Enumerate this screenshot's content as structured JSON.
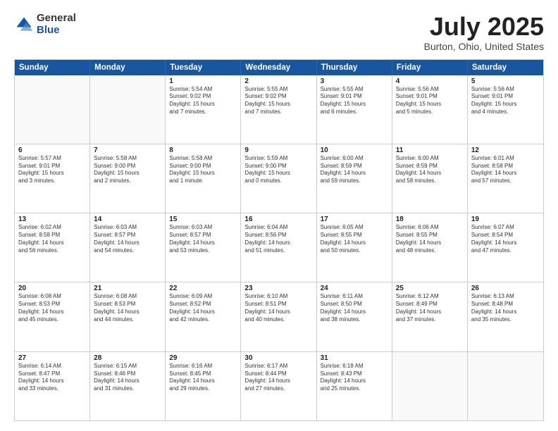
{
  "logo": {
    "general": "General",
    "blue": "Blue"
  },
  "title": "July 2025",
  "subtitle": "Burton, Ohio, United States",
  "header_days": [
    "Sunday",
    "Monday",
    "Tuesday",
    "Wednesday",
    "Thursday",
    "Friday",
    "Saturday"
  ],
  "rows": [
    [
      {
        "day": "",
        "lines": [],
        "empty": true
      },
      {
        "day": "",
        "lines": [],
        "empty": true
      },
      {
        "day": "1",
        "lines": [
          "Sunrise: 5:54 AM",
          "Sunset: 9:02 PM",
          "Daylight: 15 hours",
          "and 7 minutes."
        ]
      },
      {
        "day": "2",
        "lines": [
          "Sunrise: 5:55 AM",
          "Sunset: 9:02 PM",
          "Daylight: 15 hours",
          "and 7 minutes."
        ]
      },
      {
        "day": "3",
        "lines": [
          "Sunrise: 5:55 AM",
          "Sunset: 9:01 PM",
          "Daylight: 15 hours",
          "and 6 minutes."
        ]
      },
      {
        "day": "4",
        "lines": [
          "Sunrise: 5:56 AM",
          "Sunset: 9:01 PM",
          "Daylight: 15 hours",
          "and 5 minutes."
        ]
      },
      {
        "day": "5",
        "lines": [
          "Sunrise: 5:56 AM",
          "Sunset: 9:01 PM",
          "Daylight: 15 hours",
          "and 4 minutes."
        ]
      }
    ],
    [
      {
        "day": "6",
        "lines": [
          "Sunrise: 5:57 AM",
          "Sunset: 9:01 PM",
          "Daylight: 15 hours",
          "and 3 minutes."
        ]
      },
      {
        "day": "7",
        "lines": [
          "Sunrise: 5:58 AM",
          "Sunset: 9:00 PM",
          "Daylight: 15 hours",
          "and 2 minutes."
        ]
      },
      {
        "day": "8",
        "lines": [
          "Sunrise: 5:58 AM",
          "Sunset: 9:00 PM",
          "Daylight: 15 hours",
          "and 1 minute."
        ]
      },
      {
        "day": "9",
        "lines": [
          "Sunrise: 5:59 AM",
          "Sunset: 9:00 PM",
          "Daylight: 15 hours",
          "and 0 minutes."
        ]
      },
      {
        "day": "10",
        "lines": [
          "Sunrise: 6:00 AM",
          "Sunset: 8:59 PM",
          "Daylight: 14 hours",
          "and 59 minutes."
        ]
      },
      {
        "day": "11",
        "lines": [
          "Sunrise: 6:00 AM",
          "Sunset: 8:59 PM",
          "Daylight: 14 hours",
          "and 58 minutes."
        ]
      },
      {
        "day": "12",
        "lines": [
          "Sunrise: 6:01 AM",
          "Sunset: 8:58 PM",
          "Daylight: 14 hours",
          "and 57 minutes."
        ]
      }
    ],
    [
      {
        "day": "13",
        "lines": [
          "Sunrise: 6:02 AM",
          "Sunset: 8:58 PM",
          "Daylight: 14 hours",
          "and 56 minutes."
        ]
      },
      {
        "day": "14",
        "lines": [
          "Sunrise: 6:03 AM",
          "Sunset: 8:57 PM",
          "Daylight: 14 hours",
          "and 54 minutes."
        ]
      },
      {
        "day": "15",
        "lines": [
          "Sunrise: 6:03 AM",
          "Sunset: 8:57 PM",
          "Daylight: 14 hours",
          "and 53 minutes."
        ]
      },
      {
        "day": "16",
        "lines": [
          "Sunrise: 6:04 AM",
          "Sunset: 8:56 PM",
          "Daylight: 14 hours",
          "and 51 minutes."
        ]
      },
      {
        "day": "17",
        "lines": [
          "Sunrise: 6:05 AM",
          "Sunset: 8:55 PM",
          "Daylight: 14 hours",
          "and 50 minutes."
        ]
      },
      {
        "day": "18",
        "lines": [
          "Sunrise: 6:06 AM",
          "Sunset: 8:55 PM",
          "Daylight: 14 hours",
          "and 48 minutes."
        ]
      },
      {
        "day": "19",
        "lines": [
          "Sunrise: 6:07 AM",
          "Sunset: 8:54 PM",
          "Daylight: 14 hours",
          "and 47 minutes."
        ]
      }
    ],
    [
      {
        "day": "20",
        "lines": [
          "Sunrise: 6:08 AM",
          "Sunset: 8:53 PM",
          "Daylight: 14 hours",
          "and 45 minutes."
        ]
      },
      {
        "day": "21",
        "lines": [
          "Sunrise: 6:08 AM",
          "Sunset: 8:53 PM",
          "Daylight: 14 hours",
          "and 44 minutes."
        ]
      },
      {
        "day": "22",
        "lines": [
          "Sunrise: 6:09 AM",
          "Sunset: 8:52 PM",
          "Daylight: 14 hours",
          "and 42 minutes."
        ]
      },
      {
        "day": "23",
        "lines": [
          "Sunrise: 6:10 AM",
          "Sunset: 8:51 PM",
          "Daylight: 14 hours",
          "and 40 minutes."
        ]
      },
      {
        "day": "24",
        "lines": [
          "Sunrise: 6:11 AM",
          "Sunset: 8:50 PM",
          "Daylight: 14 hours",
          "and 38 minutes."
        ]
      },
      {
        "day": "25",
        "lines": [
          "Sunrise: 6:12 AM",
          "Sunset: 8:49 PM",
          "Daylight: 14 hours",
          "and 37 minutes."
        ]
      },
      {
        "day": "26",
        "lines": [
          "Sunrise: 6:13 AM",
          "Sunset: 8:48 PM",
          "Daylight: 14 hours",
          "and 35 minutes."
        ]
      }
    ],
    [
      {
        "day": "27",
        "lines": [
          "Sunrise: 6:14 AM",
          "Sunset: 8:47 PM",
          "Daylight: 14 hours",
          "and 33 minutes."
        ]
      },
      {
        "day": "28",
        "lines": [
          "Sunrise: 6:15 AM",
          "Sunset: 8:46 PM",
          "Daylight: 14 hours",
          "and 31 minutes."
        ]
      },
      {
        "day": "29",
        "lines": [
          "Sunrise: 6:16 AM",
          "Sunset: 8:45 PM",
          "Daylight: 14 hours",
          "and 29 minutes."
        ]
      },
      {
        "day": "30",
        "lines": [
          "Sunrise: 6:17 AM",
          "Sunset: 8:44 PM",
          "Daylight: 14 hours",
          "and 27 minutes."
        ]
      },
      {
        "day": "31",
        "lines": [
          "Sunrise: 6:18 AM",
          "Sunset: 8:43 PM",
          "Daylight: 14 hours",
          "and 25 minutes."
        ]
      },
      {
        "day": "",
        "lines": [],
        "empty": true
      },
      {
        "day": "",
        "lines": [],
        "empty": true
      }
    ]
  ]
}
